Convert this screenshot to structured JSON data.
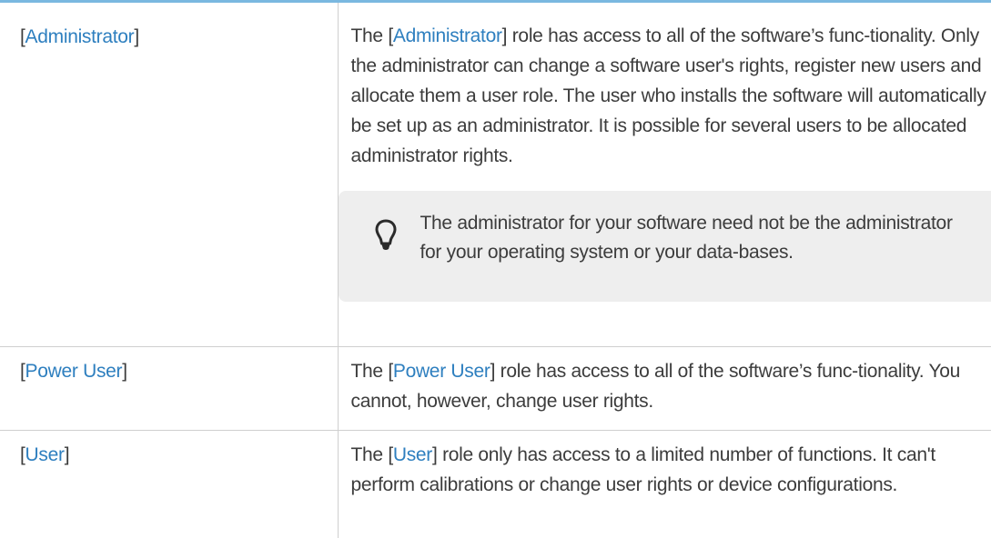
{
  "roles": [
    {
      "id": "administrator",
      "open_bracket": "[",
      "name": "Administrator",
      "close_bracket": "]",
      "desc_prefix": "The [",
      "desc_name": "Administrator",
      "desc_suffix": "] role has access to all of the software’s func-tionality. Only the administrator can change a software user's rights, register new users and allocate them a user role. The user who installs the software will automatically be set up as an administrator. It is possible for several users to be allocated administrator rights.",
      "tip": "The administrator for your software need not be the administrator for your operating system or your data-bases.",
      "tip_icon": "lightbulb-icon"
    },
    {
      "id": "power-user",
      "open_bracket": "[",
      "name": "Power User",
      "close_bracket": "]",
      "desc_prefix": "The [",
      "desc_name": "Power User",
      "desc_suffix": "] role has access to all of the software’s func-tionality. You cannot, however, change user rights."
    },
    {
      "id": "user",
      "open_bracket": "[",
      "name": "User",
      "close_bracket": "]",
      "desc_prefix": "The [",
      "desc_name": "User",
      "desc_suffix": "] role only has access to a limited number of functions. It can't perform calibrations or change user rights or device configurations."
    }
  ],
  "colors": {
    "link": "#2e7fbf",
    "text": "#3c3c3c",
    "tip_background": "#eeeeee",
    "top_rule": "#7ab8e0",
    "grid": "#cfcfcf"
  }
}
